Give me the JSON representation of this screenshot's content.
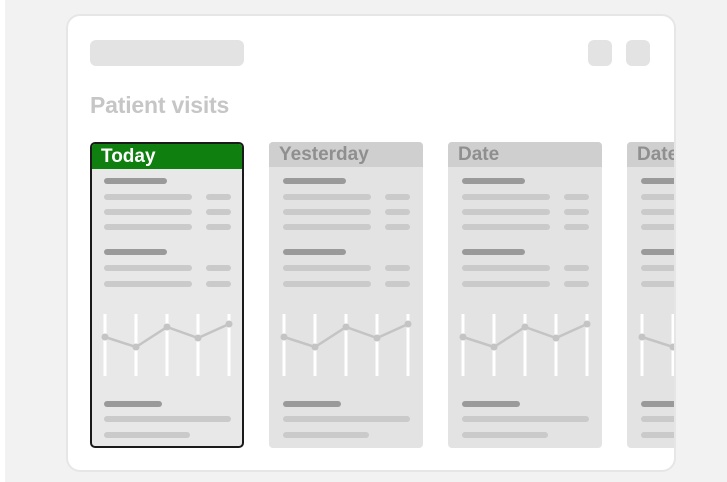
{
  "window": {
    "heading": "Patient visits"
  },
  "cards": [
    {
      "label": "Today",
      "selected": true
    },
    {
      "label": "Yesterday",
      "selected": false
    },
    {
      "label": "Date",
      "selected": false
    },
    {
      "label": "Date",
      "selected": false
    }
  ],
  "colors": {
    "selected_header": "#0f7f0f",
    "card_header": "#cfcfcf",
    "card_bg": "#e3e3e3",
    "placeholder_dark": "#9a9a9a",
    "placeholder_light": "#cacaca"
  }
}
